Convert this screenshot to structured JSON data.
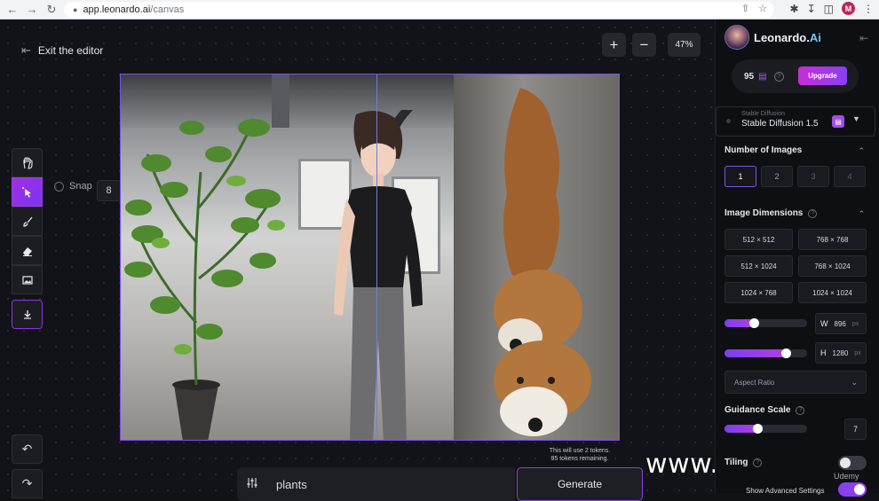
{
  "browser": {
    "url_host": "app.leonardo.ai",
    "url_path": "/canvas",
    "profile_initial": "M"
  },
  "editor": {
    "exit_label": "Exit the editor",
    "zoom_in": "+",
    "zoom_out": "−",
    "zoom_level": "47%",
    "snap_label": "Snap",
    "snap_value": "8",
    "tools": [
      "hand-icon",
      "select-icon",
      "brush-icon",
      "eraser-icon",
      "image-icon",
      "download-icon"
    ]
  },
  "prompt": {
    "value": "plants",
    "generate_label": "Generate",
    "token_note_line1": "This will use 2 tokens.",
    "token_note_line2": "95 tokens remaining."
  },
  "panel": {
    "brand_name": "Leonardo.",
    "brand_suffix": "Ai",
    "credits": "95",
    "upgrade_label": "Upgrade",
    "model_sub": "Stable Diffusion",
    "model_name": "Stable Diffusion 1.5",
    "num_images_title": "Number of Images",
    "num_images_options": [
      "1",
      "2",
      "3",
      "4"
    ],
    "num_images_selected": "1",
    "dimensions_title": "Image Dimensions",
    "dimension_options": [
      "512 × 512",
      "768 × 768",
      "512 × 1024",
      "768 × 1024",
      "1024 × 768",
      "1024 × 1024"
    ],
    "width_label": "W",
    "width_value": "896",
    "height_label": "H",
    "height_value": "1280",
    "unit": "px",
    "width_fraction": 0.36,
    "height_fraction": 0.74,
    "aspect_ratio_label": "Aspect Ratio",
    "guidance_title": "Guidance Scale",
    "guidance_value": "7",
    "guidance_fraction": 0.4,
    "tiling_label": "Tiling",
    "advanced_label": "Show Advanced Settings"
  },
  "overlay": {
    "watermark": "www.hunls.com",
    "udemy": "Udemy"
  },
  "colors": {
    "accent_purple": "#8a3ff0",
    "accent_magenta": "#c52fd8",
    "panel_bg": "#0e0f13",
    "canvas_bg": "#121318"
  }
}
